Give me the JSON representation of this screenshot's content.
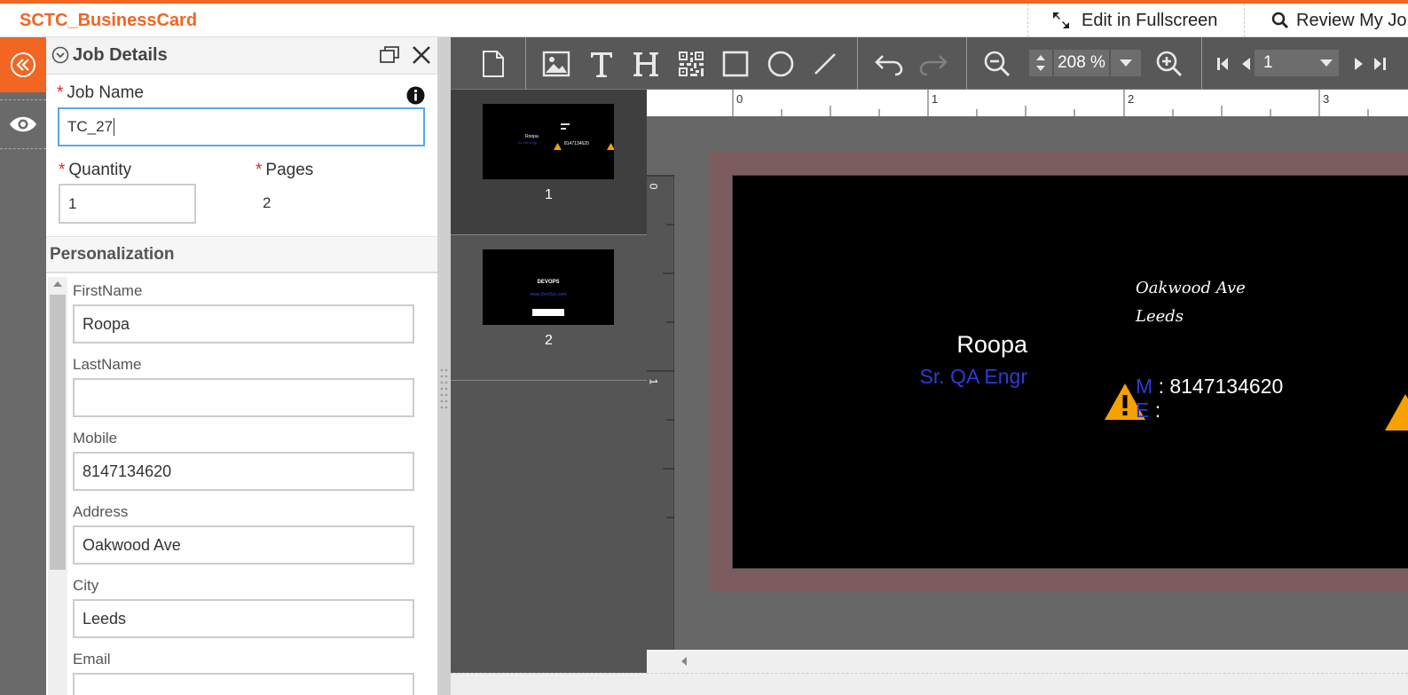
{
  "app": {
    "title": "SCTC_BusinessCard"
  },
  "top_actions": {
    "fullscreen_label": "Edit in Fullscreen",
    "review_label": "Review My Jo"
  },
  "panel": {
    "title": "Job Details",
    "job_name_label": "Job Name",
    "job_name_value": "TC_27",
    "quantity_label": "Quantity",
    "quantity_value": "1",
    "pages_label": "Pages",
    "pages_value": "2",
    "required_mark": "*",
    "section_title": "Personalization",
    "fields": {
      "firstname_label": "FirstName",
      "firstname_value": "Roopa",
      "lastname_label": "LastName",
      "lastname_value": "",
      "mobile_label": "Mobile",
      "mobile_value": "8147134620",
      "address_label": "Address",
      "address_value": "Oakwood Ave",
      "city_label": "City",
      "city_value": "Leeds",
      "email_label": "Email",
      "email_value": ""
    }
  },
  "toolbar": {
    "zoom_value": "208 %",
    "page_value": "1"
  },
  "thumbnails": [
    {
      "number": "1",
      "mini_name": "Roopa",
      "mini_title": "Sr. QA Engr",
      "mini_phone": "8147134620"
    },
    {
      "number": "2",
      "mini_heading": "DEVOPS",
      "mini_url": "www.DevOps.com"
    }
  ],
  "ruler": {
    "h_ticks": [
      "0",
      "1",
      "2",
      "3"
    ],
    "v_ticks": [
      "0",
      "1"
    ]
  },
  "card": {
    "name": "Roopa",
    "job_title": "Sr. QA Engr",
    "address_line1": "Oakwood Ave",
    "address_line2": "Leeds",
    "mobile_key": "M",
    "mobile_sep": ":",
    "mobile_value": "8147134620",
    "email_key": "E",
    "email_sep": ":"
  },
  "colors": {
    "accent": "#f26522",
    "card_blue": "#2e3bd6",
    "warning": "#f5a100"
  }
}
